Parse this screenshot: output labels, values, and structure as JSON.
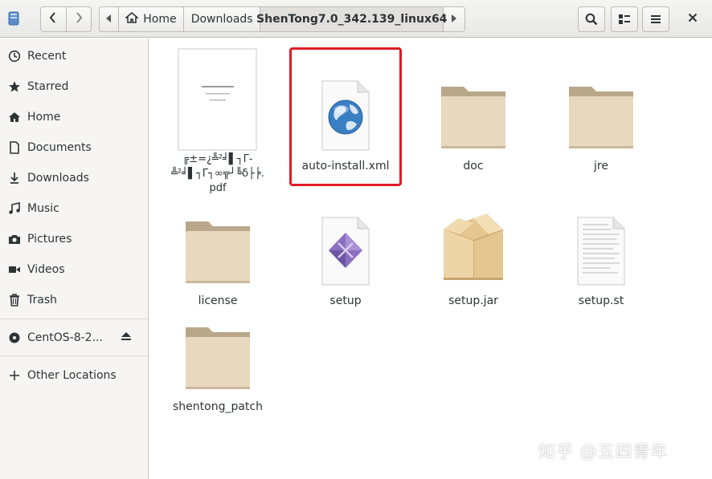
{
  "header": {
    "path": {
      "home": "Home",
      "downloads": "Downloads",
      "current": "ShenTong7.0_342.139_linux64"
    }
  },
  "sidebar": {
    "items": [
      {
        "label": "Recent",
        "icon": "clock-icon"
      },
      {
        "label": "Starred",
        "icon": "star-icon"
      },
      {
        "label": "Home",
        "icon": "home-icon"
      },
      {
        "label": "Documents",
        "icon": "document-icon"
      },
      {
        "label": "Downloads",
        "icon": "download-icon"
      },
      {
        "label": "Music",
        "icon": "music-icon"
      },
      {
        "label": "Pictures",
        "icon": "camera-icon"
      },
      {
        "label": "Videos",
        "icon": "video-icon"
      },
      {
        "label": "Trash",
        "icon": "trash-icon"
      }
    ],
    "device": {
      "label": "CentOS-8-2...",
      "icon": "disc-icon"
    },
    "other": {
      "label": "Other Locations",
      "icon": "plus-icon"
    }
  },
  "files": [
    {
      "name": "╔±=¿╩²╛▌┐Γ-\n╩²╛▌┐Γ┐∞╦┘╚δ├╞.\npdf",
      "type": "pdf"
    },
    {
      "name": "auto-install.xml",
      "type": "xml"
    },
    {
      "name": "doc",
      "type": "folder"
    },
    {
      "name": "jre",
      "type": "folder"
    },
    {
      "name": "license",
      "type": "folder"
    },
    {
      "name": "setup",
      "type": "executable"
    },
    {
      "name": "setup.jar",
      "type": "archive"
    },
    {
      "name": "setup.st",
      "type": "text"
    },
    {
      "name": "shentong_patch",
      "type": "folder"
    }
  ],
  "selected_file": "auto-install.xml",
  "watermark": "知乎 @五四青年",
  "colors": {
    "selection_outline": "#e01b24",
    "folder": "#e8d8be",
    "sidebar_bg": "#f6f5f4"
  }
}
